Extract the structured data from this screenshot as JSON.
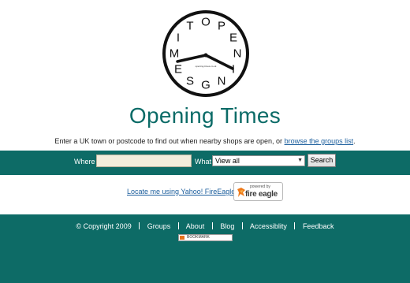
{
  "clock": {
    "letters": [
      "O",
      "P",
      "E",
      "N",
      "I",
      "N",
      "G",
      "S",
      "E",
      "M",
      "I",
      "T"
    ],
    "center_text": "opening-times.co.uk",
    "ring_words": [
      "OPENING",
      "TIMES"
    ]
  },
  "site_title": "Opening Times",
  "intro": {
    "text": "Enter a UK town or postcode to find out when nearby shops are open, or",
    "link": "browse the groups list",
    "end": "."
  },
  "search": {
    "where_label": "Where",
    "where_value": "",
    "what_label": "What",
    "what_selected": "View all",
    "button_label": "Search"
  },
  "locate": {
    "link": "Locate me using Yahoo! FireEagle",
    "badge_powered": "powered by",
    "badge_name": "fire eagle"
  },
  "footer": {
    "copyright": "© Copyright 2009",
    "links": [
      "Groups",
      "About",
      "Blog",
      "Accessiblity",
      "Feedback"
    ],
    "bookmark_label": "BOOKMARK"
  },
  "colors": {
    "accent": "#0d6b66",
    "title": "#0b6b67",
    "link": "#1a5d9c"
  }
}
